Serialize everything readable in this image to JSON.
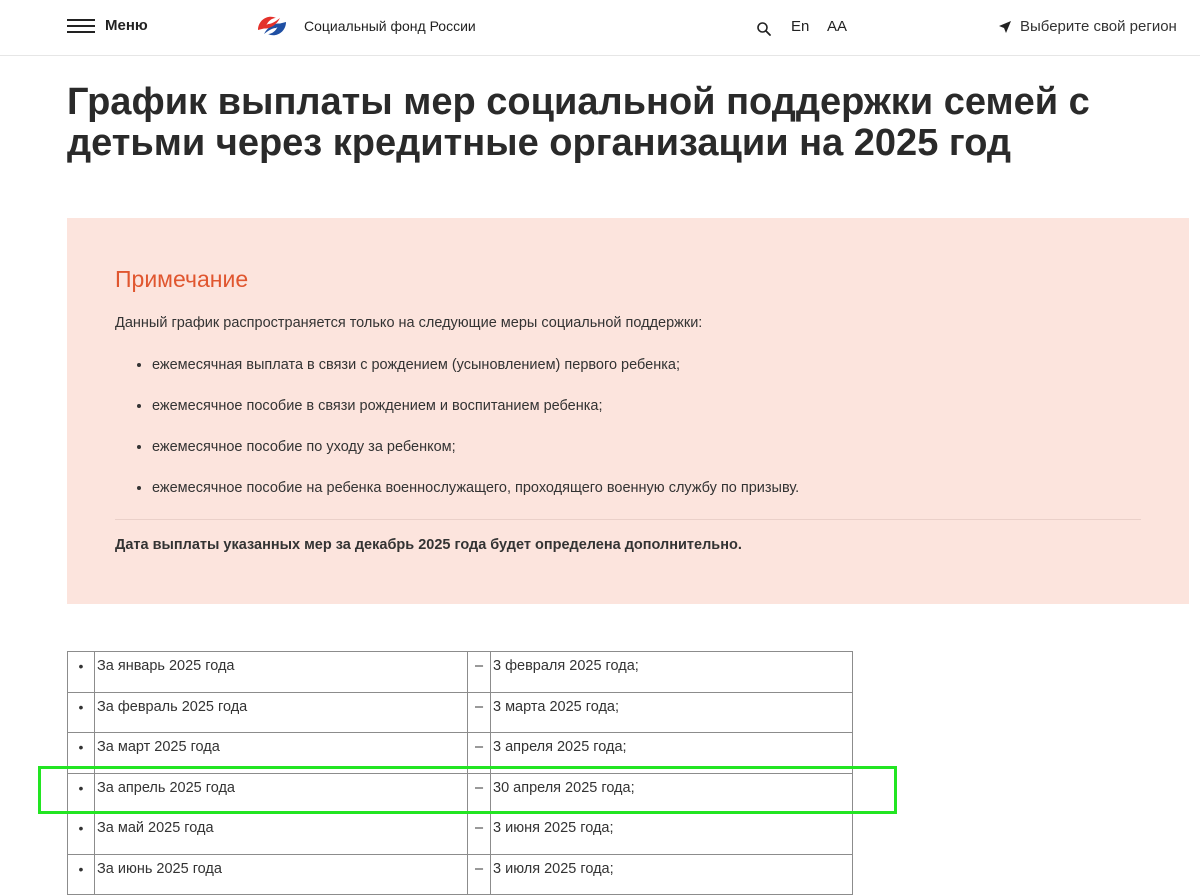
{
  "header": {
    "menu_label": "Меню",
    "logo_text": "Социальный фонд России",
    "lang_label": "En",
    "font_size_label": "АА",
    "region_label": "Выберите свой регион"
  },
  "page": {
    "title": "График выплаты мер социальной поддержки семей с детьми через кредитные организации на 2025 год"
  },
  "note": {
    "title": "Примечание",
    "intro": "Данный график распространяется только на следующие меры социальной поддержки:",
    "items": [
      "ежемесячная выплата в связи с рождением (усыновлением) первого ребенка;",
      "ежемесячное пособие в связи рождением и воспитанием ребенка;",
      "ежемесячное пособие по уходу за ребенком;",
      "ежемесячное пособие на ребенка военнослужащего, проходящего военную службу по призыву."
    ],
    "bold_text": "Дата выплаты указанных мер за декабрь 2025 года будет определена дополнительно."
  },
  "schedule": {
    "rows": [
      {
        "bullet": "•",
        "period": "За январь 2025 года",
        "dash": "–",
        "date": "3 февраля 2025 года;"
      },
      {
        "bullet": "•",
        "period": "За февраль 2025 года",
        "dash": "–",
        "date": "3 марта 2025 года;"
      },
      {
        "bullet": "•",
        "period": "За март 2025 года",
        "dash": "–",
        "date": "3 апреля 2025 года;"
      },
      {
        "bullet": "•",
        "period": "За апрель 2025 года",
        "dash": "–",
        "date": "30 апреля 2025 года;"
      },
      {
        "bullet": "•",
        "period": "За май 2025 года",
        "dash": "–",
        "date": "3 июня 2025 года;"
      },
      {
        "bullet": "•",
        "period": "За июнь 2025 года",
        "dash": "–",
        "date": "3 июля 2025 года;"
      }
    ]
  },
  "colors": {
    "accent": "#e0562f",
    "note_background": "#fce4dd",
    "highlight": "#22e522"
  }
}
